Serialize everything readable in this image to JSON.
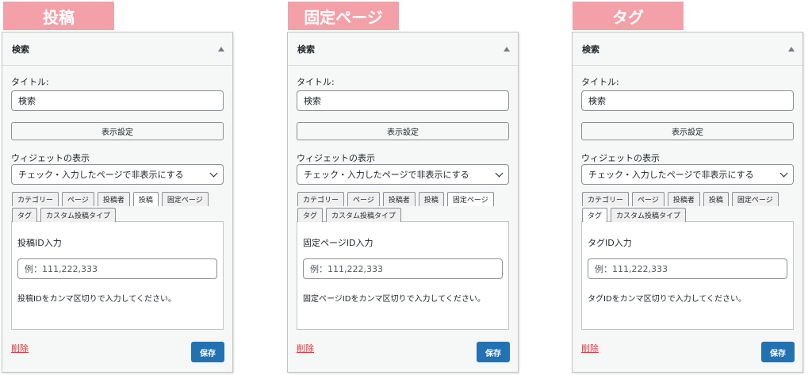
{
  "widgets": [
    {
      "badge": "投稿",
      "header": "検索",
      "title_label": "タイトル:",
      "title_value": "検索",
      "display_button": "表示設定",
      "visibility_label": "ウィジェットの表示",
      "visibility_select": "チェック・入力したページで非表示にする",
      "tabs_row1": [
        "カテゴリー",
        "ページ",
        "投稿者",
        "投稿",
        "固定ページ"
      ],
      "tabs_row2": [
        "タグ",
        "カスタム投稿タイプ"
      ],
      "active_tab": "投稿",
      "id_label": "投稿ID入力",
      "id_placeholder": "例：111,222,333",
      "help_text": "投稿IDをカンマ区切りで入力してください。",
      "delete_label": "削除",
      "save_label": "保存"
    },
    {
      "badge": "固定ページ",
      "header": "検索",
      "title_label": "タイトル:",
      "title_value": "検索",
      "display_button": "表示設定",
      "visibility_label": "ウィジェットの表示",
      "visibility_select": "チェック・入力したページで非表示にする",
      "tabs_row1": [
        "カテゴリー",
        "ページ",
        "投稿者",
        "投稿",
        "固定ページ"
      ],
      "tabs_row2": [
        "タグ",
        "カスタム投稿タイプ"
      ],
      "active_tab": "固定ページ",
      "id_label": "固定ページID入力",
      "id_placeholder": "例：111,222,333",
      "help_text": "固定ページIDをカンマ区切りで入力してください。",
      "delete_label": "削除",
      "save_label": "保存"
    },
    {
      "badge": "タグ",
      "header": "検索",
      "title_label": "タイトル:",
      "title_value": "検索",
      "display_button": "表示設定",
      "visibility_label": "ウィジェットの表示",
      "visibility_select": "チェック・入力したページで非表示にする",
      "tabs_row1": [
        "カテゴリー",
        "ページ",
        "投稿者",
        "投稿",
        "固定ページ"
      ],
      "tabs_row2": [
        "タグ",
        "カスタム投稿タイプ"
      ],
      "active_tab": "タグ",
      "id_label": "タグID入力",
      "id_placeholder": "例：111,222,333",
      "help_text": "タグIDをカンマ区切りで入力してください。",
      "delete_label": "削除",
      "save_label": "保存"
    }
  ],
  "colors": {
    "badge": "#f4a0a8",
    "save_button": "#2271b1",
    "delete_link": "#d63638"
  },
  "icons": {
    "collapse": "triangle-up-icon",
    "select": "chevron-down-icon"
  }
}
